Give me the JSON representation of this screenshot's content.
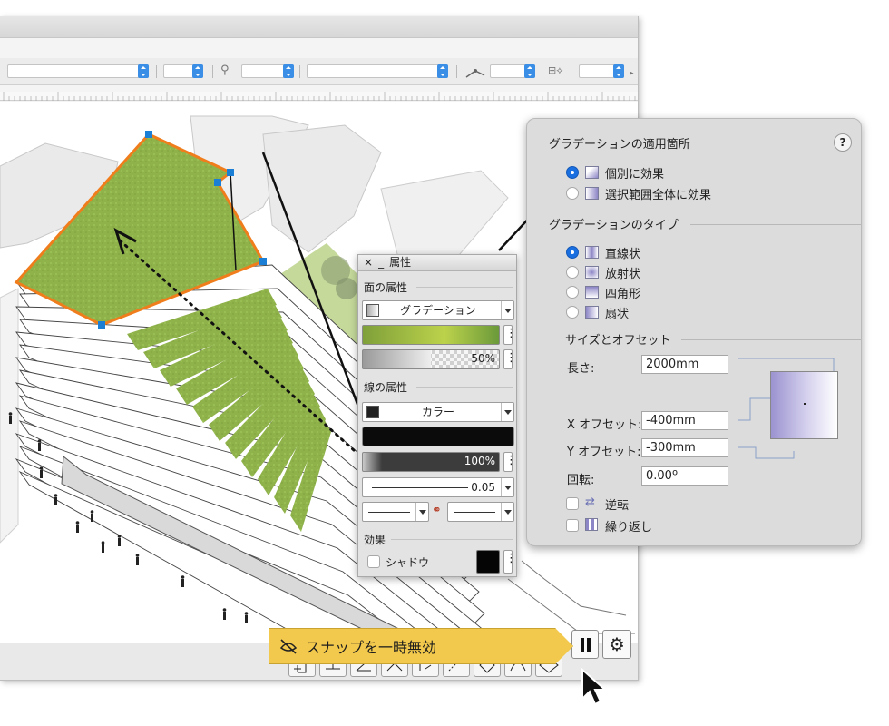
{
  "tooltip": {
    "text": "スナップを一時無効"
  },
  "attributes": {
    "title": "属性",
    "close": "×",
    "minimize": "_",
    "fill_section": "面の属性",
    "fill_type": "グラデーション",
    "fill_opacity": "50%",
    "line_section": "線の属性",
    "line_type": "カラー",
    "line_opacity": "100%",
    "line_weight": "0.05",
    "effects_section": "効果",
    "shadow_label": "シャドウ"
  },
  "gradient_panel": {
    "apply_heading": "グラデーションの適用箇所",
    "help": "?",
    "apply_options": [
      {
        "label": "個別に効果",
        "selected": true
      },
      {
        "label": "選択範囲全体に効果",
        "selected": false
      }
    ],
    "type_heading": "グラデーションのタイプ",
    "type_options": [
      {
        "label": "直線状",
        "selected": true
      },
      {
        "label": "放射状",
        "selected": false
      },
      {
        "label": "四角形",
        "selected": false
      },
      {
        "label": "扇状",
        "selected": false
      }
    ],
    "size_heading": "サイズとオフセット",
    "length_label": "長さ:",
    "length_value": "2000mm",
    "x_offset_label": "X オフセット:",
    "x_offset_value": "-400mm",
    "y_offset_label": "Y オフセット:",
    "y_offset_value": "-300mm",
    "rotation_label": "回転:",
    "rotation_value": "0.00º",
    "reverse_label": "逆転",
    "repeat_label": "繰り返し"
  },
  "colors": {
    "accent_blue": "#1a6fe0",
    "selection_orange": "#f07d1c",
    "grass_green": "#8fb24a",
    "tooltip_yellow": "#f2c94c"
  }
}
